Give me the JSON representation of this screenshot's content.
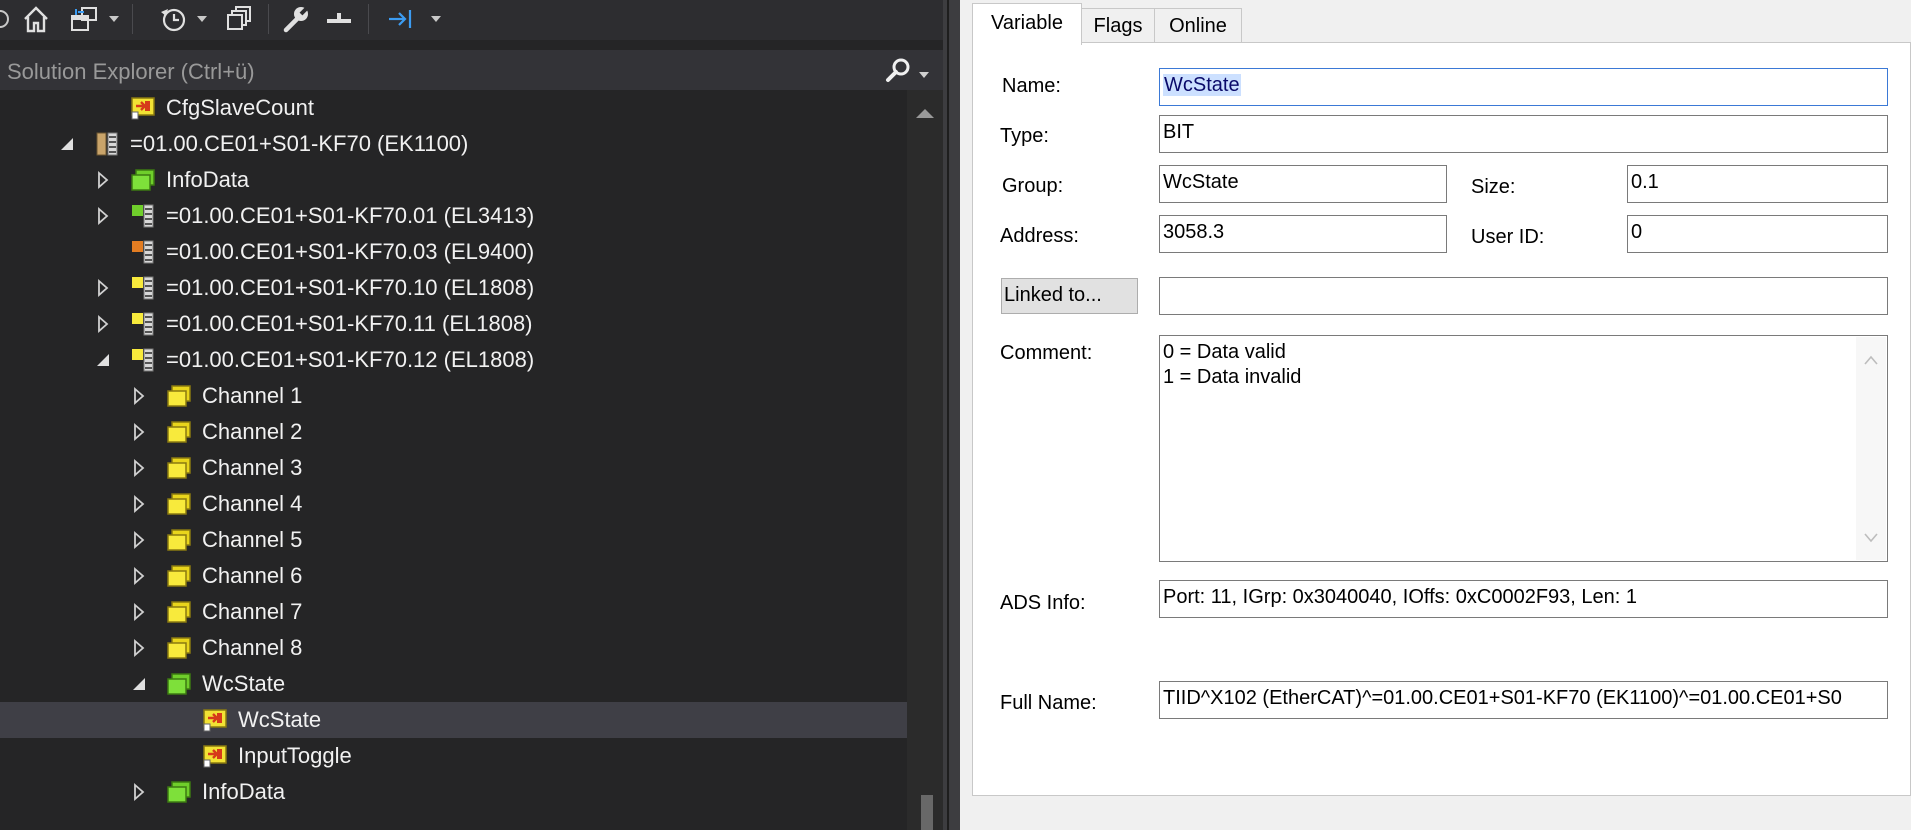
{
  "toolbar": {
    "icons": [
      "partial-button-icon",
      "home-icon",
      "sync-windows-icon",
      "dropdown-arrow-icon",
      "history-icon",
      "dropdown-arrow-icon",
      "copy-windows-icon",
      "wrench-icon",
      "minus-icon",
      "collapse-arrow-icon",
      "dropdown-arrow-icon"
    ]
  },
  "search": {
    "placeholder": "Solution Explorer (Ctrl+ü)",
    "icon": "search-icon"
  },
  "tree": {
    "items": [
      {
        "label": "CfgSlaveCount",
        "icon": "variable-yellow-icon",
        "expander": "none",
        "indent": 4
      },
      {
        "label": "=01.00.CE01+S01-KF70 (EK1100)",
        "icon": "coupler-icon",
        "expander": "expanded",
        "indent": 3
      },
      {
        "label": "InfoData",
        "icon": "green-folder-icon",
        "expander": "collapsed",
        "indent": 4
      },
      {
        "label": "=01.00.CE01+S01-KF70.01 (EL3413)",
        "icon": "terminal-green-icon",
        "expander": "collapsed",
        "indent": 4
      },
      {
        "label": "=01.00.CE01+S01-KF70.03 (EL9400)",
        "icon": "terminal-orange-icon",
        "expander": "none",
        "indent": 4
      },
      {
        "label": "=01.00.CE01+S01-KF70.10 (EL1808)",
        "icon": "terminal-yellow-icon",
        "expander": "collapsed",
        "indent": 4
      },
      {
        "label": "=01.00.CE01+S01-KF70.11 (EL1808)",
        "icon": "terminal-yellow-icon",
        "expander": "collapsed",
        "indent": 4
      },
      {
        "label": "=01.00.CE01+S01-KF70.12 (EL1808)",
        "icon": "terminal-yellow-icon",
        "expander": "expanded",
        "indent": 4
      },
      {
        "label": "Channel 1",
        "icon": "yellow-folder-icon",
        "expander": "collapsed",
        "indent": 5
      },
      {
        "label": "Channel 2",
        "icon": "yellow-folder-icon",
        "expander": "collapsed",
        "indent": 5
      },
      {
        "label": "Channel 3",
        "icon": "yellow-folder-icon",
        "expander": "collapsed",
        "indent": 5
      },
      {
        "label": "Channel 4",
        "icon": "yellow-folder-icon",
        "expander": "collapsed",
        "indent": 5
      },
      {
        "label": "Channel 5",
        "icon": "yellow-folder-icon",
        "expander": "collapsed",
        "indent": 5
      },
      {
        "label": "Channel 6",
        "icon": "yellow-folder-icon",
        "expander": "collapsed",
        "indent": 5
      },
      {
        "label": "Channel 7",
        "icon": "yellow-folder-icon",
        "expander": "collapsed",
        "indent": 5
      },
      {
        "label": "Channel 8",
        "icon": "yellow-folder-icon",
        "expander": "collapsed",
        "indent": 5
      },
      {
        "label": "WcState",
        "icon": "green-folder-icon",
        "expander": "expanded",
        "indent": 5
      },
      {
        "label": "WcState",
        "icon": "variable-yellow-icon",
        "expander": "none",
        "indent": 6,
        "selected": true
      },
      {
        "label": "InputToggle",
        "icon": "variable-yellow-icon",
        "expander": "none",
        "indent": 6
      },
      {
        "label": "InfoData",
        "icon": "green-folder-icon",
        "expander": "collapsed",
        "indent": 5
      }
    ]
  },
  "tabs": [
    {
      "label": "Variable",
      "active": true
    },
    {
      "label": "Flags",
      "active": false
    },
    {
      "label": "Online",
      "active": false
    }
  ],
  "form": {
    "name_label": "Name:",
    "name_value": "WcState",
    "type_label": "Type:",
    "type_value": "BIT",
    "group_label": "Group:",
    "group_value": "WcState",
    "size_label": "Size:",
    "size_value": "0.1",
    "address_label": "Address:",
    "address_value": "3058.3",
    "userid_label": "User ID:",
    "userid_value": "0",
    "linked_button": "Linked to...",
    "linked_value": "",
    "comment_label": "Comment:",
    "comment_lines": [
      "0 = Data valid",
      "1 = Data invalid"
    ],
    "ads_label": "ADS Info:",
    "ads_value": "Port: 11, IGrp: 0x3040040, IOffs: 0xC0002F93, Len: 1",
    "fullname_label": "Full Name:",
    "fullname_value": "TIID^X102 (EtherCAT)^=01.00.CE01+S01-KF70 (EK1100)^=01.00.CE01+S0"
  },
  "colors": {
    "dark_bg": "#252526",
    "toolbar_bg": "#2d2d30",
    "selection": "#3f3f46",
    "folder_green": "#6fce2b",
    "folder_yellow": "#f2e234",
    "terminal_orange": "#e37d22",
    "panel_bg": "#f0f0f0",
    "text_highlight": "#cce0ff",
    "accent_blue": "#3b79d6"
  }
}
